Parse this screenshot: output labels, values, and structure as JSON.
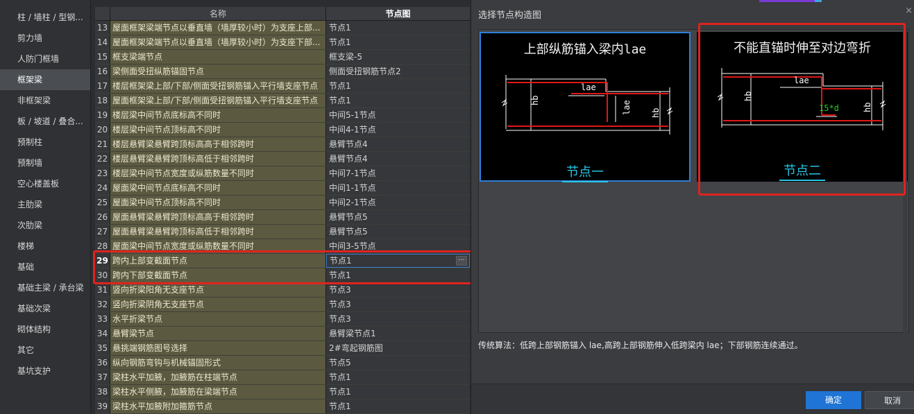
{
  "sidebar": {
    "items": [
      {
        "label": "柱 / 墙柱 / 型钢...",
        "active": false
      },
      {
        "label": "剪力墙",
        "active": false
      },
      {
        "label": "人防门框墙",
        "active": false
      },
      {
        "label": "框架梁",
        "active": true
      },
      {
        "label": "非框架梁",
        "active": false
      },
      {
        "label": "板 / 坡道 / 叠合...",
        "active": false
      },
      {
        "label": "预制柱",
        "active": false
      },
      {
        "label": "预制墙",
        "active": false
      },
      {
        "label": "空心楼盖板",
        "active": false
      },
      {
        "label": "主肋梁",
        "active": false
      },
      {
        "label": "次肋梁",
        "active": false
      },
      {
        "label": "楼梯",
        "active": false
      },
      {
        "label": "基础",
        "active": false
      },
      {
        "label": "基础主梁 / 承台梁",
        "active": false
      },
      {
        "label": "基础次梁",
        "active": false
      },
      {
        "label": "砌体结构",
        "active": false
      },
      {
        "label": "其它",
        "active": false
      },
      {
        "label": "基坑支护",
        "active": false
      }
    ]
  },
  "grid": {
    "header": {
      "name": "名称",
      "node": "节点图"
    },
    "selected_row": 29,
    "rows": [
      {
        "num": "13",
        "name": "屋面框架梁端节点以垂直墙（墙厚较小时）为支座上部...",
        "node": "节点1"
      },
      {
        "num": "14",
        "name": "屋面框架梁端节点以垂直墙（墙厚较小时）为支座下部...",
        "node": "节点1"
      },
      {
        "num": "15",
        "name": "框支梁端节点",
        "node": "框支梁-5"
      },
      {
        "num": "16",
        "name": "梁侧面受扭纵筋锚固节点",
        "node": "侧面受扭钢筋节点2"
      },
      {
        "num": "17",
        "name": "楼层框架梁上部/下部/侧面受扭钢筋锚入平行墙支座节点",
        "node": "节点1"
      },
      {
        "num": "18",
        "name": "屋面框架梁上部/下部/侧面受扭钢筋锚入平行墙支座节点",
        "node": "节点1"
      },
      {
        "num": "19",
        "name": "楼层梁中间节点底标高不同时",
        "node": "中间5-1节点"
      },
      {
        "num": "20",
        "name": "楼层梁中间节点顶标高不同时",
        "node": "中间4-1节点"
      },
      {
        "num": "21",
        "name": "楼层悬臂梁悬臂跨顶标高高于相邻跨时",
        "node": "悬臂节点4"
      },
      {
        "num": "22",
        "name": "楼层悬臂梁悬臂跨顶标高低于相邻跨时",
        "node": "悬臂节点4"
      },
      {
        "num": "23",
        "name": "楼层梁中间节点宽度或纵筋数量不同时",
        "node": "中间7-1节点"
      },
      {
        "num": "24",
        "name": "屋面梁中间节点底标高不同时",
        "node": "中间1-1节点"
      },
      {
        "num": "25",
        "name": "屋面梁中间节点顶标高不同时",
        "node": "中间2-1节点"
      },
      {
        "num": "26",
        "name": "屋面悬臂梁悬臂跨顶标高高于相邻跨时",
        "node": "悬臂节点5"
      },
      {
        "num": "27",
        "name": "屋面悬臂梁悬臂跨顶标高低于相邻跨时",
        "node": "悬臂节点5"
      },
      {
        "num": "28",
        "name": "屋面梁中间节点宽度或纵筋数量不同时",
        "node": "中间3-5节点"
      },
      {
        "num": "29",
        "name": "跨内上部变截面节点",
        "node": "节点1",
        "ellipsis": "···"
      },
      {
        "num": "30",
        "name": "跨内下部变截面节点",
        "node": "节点1"
      },
      {
        "num": "31",
        "name": "竖向折梁阳角无支座节点",
        "node": "节点3"
      },
      {
        "num": "32",
        "name": "竖向折梁阴角无支座节点",
        "node": "节点3"
      },
      {
        "num": "33",
        "name": "水平折梁节点",
        "node": "节点3"
      },
      {
        "num": "34",
        "name": "悬臂梁节点",
        "node": "悬臂梁节点1"
      },
      {
        "num": "35",
        "name": "悬挑端钢筋图号选择",
        "node": "2#弯起钢筋图"
      },
      {
        "num": "36",
        "name": "纵向钢筋弯钩与机械锚固形式",
        "node": "节点5"
      },
      {
        "num": "37",
        "name": "梁柱水平加腋，加腋筋在柱端节点",
        "node": "节点1"
      },
      {
        "num": "38",
        "name": "梁柱水平侧腋，加腋筋在梁端节点",
        "node": "节点1"
      },
      {
        "num": "39",
        "name": "梁柱水平加腋附加箍筋节点",
        "node": "节点1"
      }
    ]
  },
  "dialog": {
    "title": "选择节点构造图",
    "close_glyph": "×",
    "thumbnails": [
      {
        "title": "上部纵筋锚入梁内lae",
        "label": "节点一",
        "selected": true,
        "texts": {
          "hb_left": "hb",
          "lae": "lae",
          "lae_vertical": "lae",
          "hb_right": "hb"
        }
      },
      {
        "title": "不能直锚时伸至对边弯折",
        "label": "节点二",
        "selected": false,
        "texts": {
          "hb_left": "hb",
          "lae": "lae",
          "bend": "15*d",
          "hb_right": "hb"
        }
      }
    ],
    "description": "传统算法：低跨上部钢筋锚入 lae,高跨上部钢筋伸入低跨梁内 lae；下部钢筋连续通过。",
    "ok_label": "确定",
    "cancel_label": "取消"
  },
  "colors": {
    "accent": "#1f74d6",
    "highlight": "#e0231f",
    "rebar": "#e01818",
    "label_cyan": "#27c7e6",
    "name_cell_bg": "#5b5a40"
  }
}
